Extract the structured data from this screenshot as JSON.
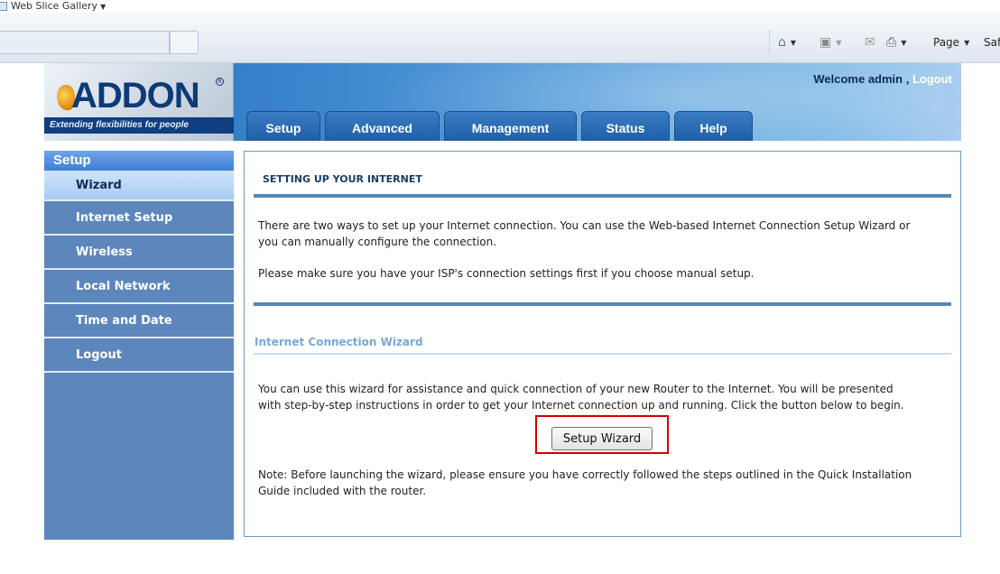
{
  "browser": {
    "favorites_bar": {
      "web_slice_label": "Web Slice Gallery"
    },
    "command_bar": {
      "page_label": "Page",
      "safety_label_partial": "Saf"
    }
  },
  "router": {
    "brand": {
      "logo_text": "ADDON",
      "tagline": "Extending flexibilities for people"
    },
    "welcome": {
      "prefix": "Welcome admin , ",
      "logout_link": "Logout"
    },
    "nav_tabs": [
      {
        "label": "Setup"
      },
      {
        "label": "Advanced"
      },
      {
        "label": "Management"
      },
      {
        "label": "Status"
      },
      {
        "label": "Help"
      }
    ],
    "sidebar": {
      "header": "Setup",
      "items": [
        {
          "label": "Wizard",
          "active": true
        },
        {
          "label": "Internet Setup"
        },
        {
          "label": "Wireless"
        },
        {
          "label": "Local Network"
        },
        {
          "label": "Time and Date"
        },
        {
          "label": "Logout"
        }
      ]
    },
    "content": {
      "section_title": "SETTING UP YOUR INTERNET",
      "intro_line1": "There are two ways to set up your Internet connection. You can use the Web-based Internet Connection Setup Wizard or",
      "intro_line2": "you can manually configure the connection.",
      "isp_note": "Please make sure you have your ISP's connection settings first if you choose manual setup.",
      "wizard_title": "Internet Connection Wizard",
      "wizard_desc_line1": "You can use this wizard for assistance and quick connection of your new Router to the Internet. You will be presented",
      "wizard_desc_line2": "with step-by-step instructions in order to get your Internet connection up and running. Click the button below to begin.",
      "setup_wizard_button": "Setup Wizard",
      "note_line1": "Note: Before launching the wizard, please ensure you have correctly followed the steps outlined in the Quick Installation",
      "note_line2": "Guide included with the router."
    },
    "highlight_color": "#d40000"
  }
}
